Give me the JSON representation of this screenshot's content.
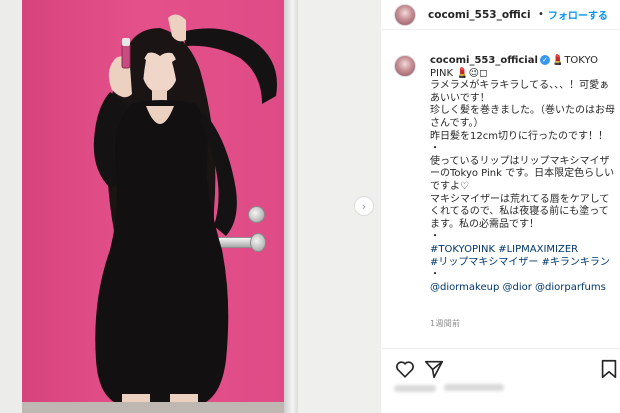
{
  "post": {
    "username": "cocomi_553_offici",
    "separator": "•",
    "follow_label": "フォローする",
    "next_glyph": "›"
  },
  "caption": {
    "username": "cocomi_553_official",
    "verified_glyph": "✓",
    "emoji_line": "💄TOKYO PINK 💄😉◻",
    "lines": [
      "ラメラメがキラキラしてる、、、！可愛ぁあいいです！",
      "珍しく髪を巻きました。（巻いたのはお母さんです。）",
      "昨日髪を12cm切りに行ったのです！！",
      "・",
      "使っているリップはリップマキシマイザーのTokyo Pink です。日本限定色らしいですよ♡",
      "マキシマイザーは荒れてる唇をケアしてくれてるので、私は夜寝る前にも塗ってます。私の必需品です！",
      "・"
    ],
    "hashtags": [
      "#TOKYOPINK #LIPMAXIMIZER",
      "#リップマキシマイザー #キランキラン",
      "・",
      "@diormakeup @dior @diorparfums"
    ],
    "time": "1週間前"
  },
  "icons": {
    "like": "heart-icon",
    "share": "paper-plane-icon",
    "save": "bookmark-icon",
    "next": "chevron-right-icon"
  },
  "colors": {
    "accent": "#0095f6",
    "verified": "#3897f0",
    "tag": "#00376b",
    "door": "#e0508a"
  }
}
